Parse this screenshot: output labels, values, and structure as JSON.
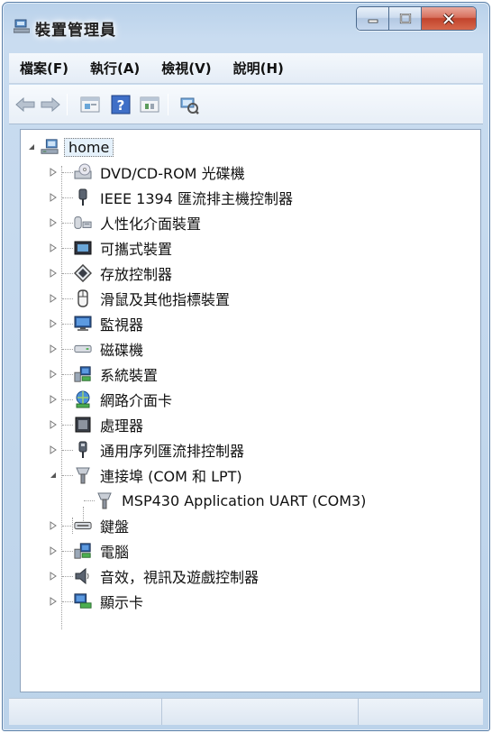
{
  "window": {
    "title": "裝置管理員"
  },
  "menu": {
    "items": [
      "檔案(F)",
      "執行(A)",
      "檢視(V)",
      "說明(H)"
    ]
  },
  "toolbar": {
    "buttons": [
      "back-arrow",
      "forward-arrow",
      "properties",
      "help",
      "show-hidden",
      "scan-hardware"
    ]
  },
  "tree": {
    "root": "home",
    "categories": [
      {
        "label": "DVD/CD-ROM 光碟機",
        "icon": "dvd-drive-icon",
        "expanded": false
      },
      {
        "label": "IEEE 1394 匯流排主機控制器",
        "icon": "ieee1394-icon",
        "expanded": false
      },
      {
        "label": "人性化介面裝置",
        "icon": "hid-icon",
        "expanded": false
      },
      {
        "label": "可攜式裝置",
        "icon": "portable-device-icon",
        "expanded": false
      },
      {
        "label": "存放控制器",
        "icon": "storage-controller-icon",
        "expanded": false
      },
      {
        "label": "滑鼠及其他指標裝置",
        "icon": "mouse-icon",
        "expanded": false
      },
      {
        "label": "監視器",
        "icon": "monitor-icon",
        "expanded": false
      },
      {
        "label": "磁碟機",
        "icon": "disk-drive-icon",
        "expanded": false
      },
      {
        "label": "系統裝置",
        "icon": "system-device-icon",
        "expanded": false
      },
      {
        "label": "網路介面卡",
        "icon": "network-adapter-icon",
        "expanded": false
      },
      {
        "label": "處理器",
        "icon": "processor-icon",
        "expanded": false
      },
      {
        "label": "通用序列匯流排控制器",
        "icon": "usb-controller-icon",
        "expanded": false
      },
      {
        "label": "連接埠 (COM 和 LPT)",
        "icon": "port-icon",
        "expanded": true,
        "children": [
          {
            "label": "MSP430 Application UART (COM3)",
            "icon": "port-icon"
          }
        ]
      },
      {
        "label": "鍵盤",
        "icon": "keyboard-icon",
        "expanded": false
      },
      {
        "label": "電腦",
        "icon": "computer-icon",
        "expanded": false
      },
      {
        "label": "音效，視訊及遊戲控制器",
        "icon": "sound-icon",
        "expanded": false
      },
      {
        "label": "顯示卡",
        "icon": "display-adapter-icon",
        "expanded": false
      }
    ]
  },
  "colors": {
    "titlebar": "#b9d1ea",
    "close_button": "#c2432c",
    "selection": "#e5f1fb"
  }
}
